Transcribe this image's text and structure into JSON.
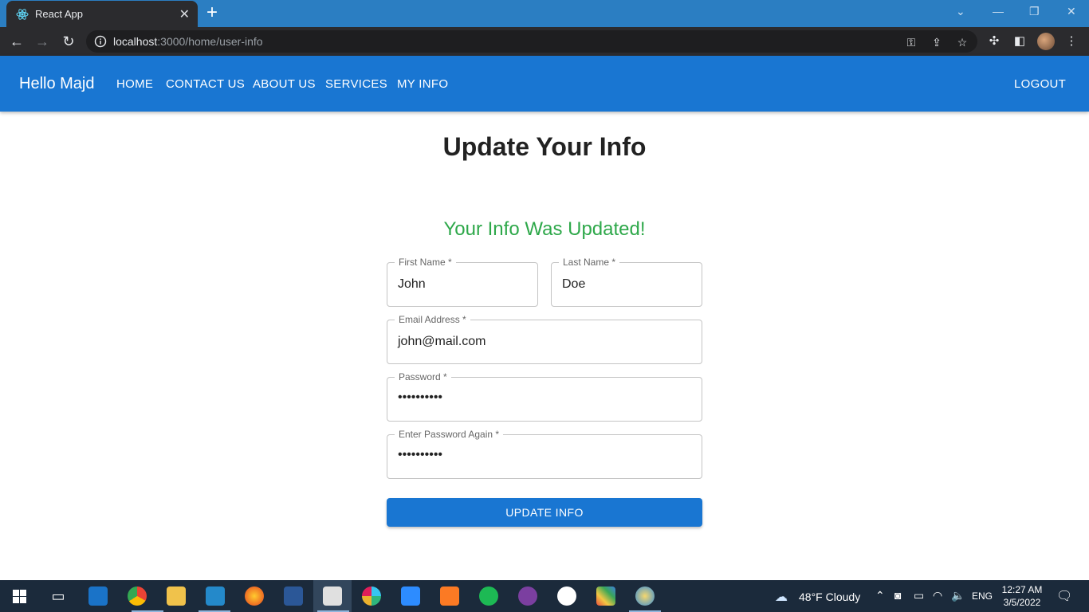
{
  "browser": {
    "tab_title": "React App",
    "tab_close": "✕",
    "new_tab": "+",
    "url_host": "localhost",
    "url_rest": ":3000/home/user-info"
  },
  "appbar": {
    "brand": "Hello Majd",
    "nav": [
      "HOME",
      "CONTACT US",
      "ABOUT US",
      "SERVICES",
      "MY INFO"
    ],
    "logout": "LOGOUT",
    "color": "#1976d2"
  },
  "main": {
    "title": "Update Your Info",
    "success_message": "Your Info Was Updated!",
    "success_color": "#2ea84a",
    "fields": {
      "first_name": {
        "label": "First Name *",
        "value": "John"
      },
      "last_name": {
        "label": "Last Name *",
        "value": "Doe"
      },
      "email": {
        "label": "Email Address *",
        "value": "john@mail.com"
      },
      "password": {
        "label": "Password *",
        "value": "••••••••••"
      },
      "password_again": {
        "label": "Enter Password Again *",
        "value": "••••••••••"
      }
    },
    "submit_label": "UPDATE INFO"
  },
  "taskbar": {
    "weather": "48°F  Cloudy",
    "language": "ENG",
    "time": "12:27 AM",
    "date": "3/5/2022"
  }
}
